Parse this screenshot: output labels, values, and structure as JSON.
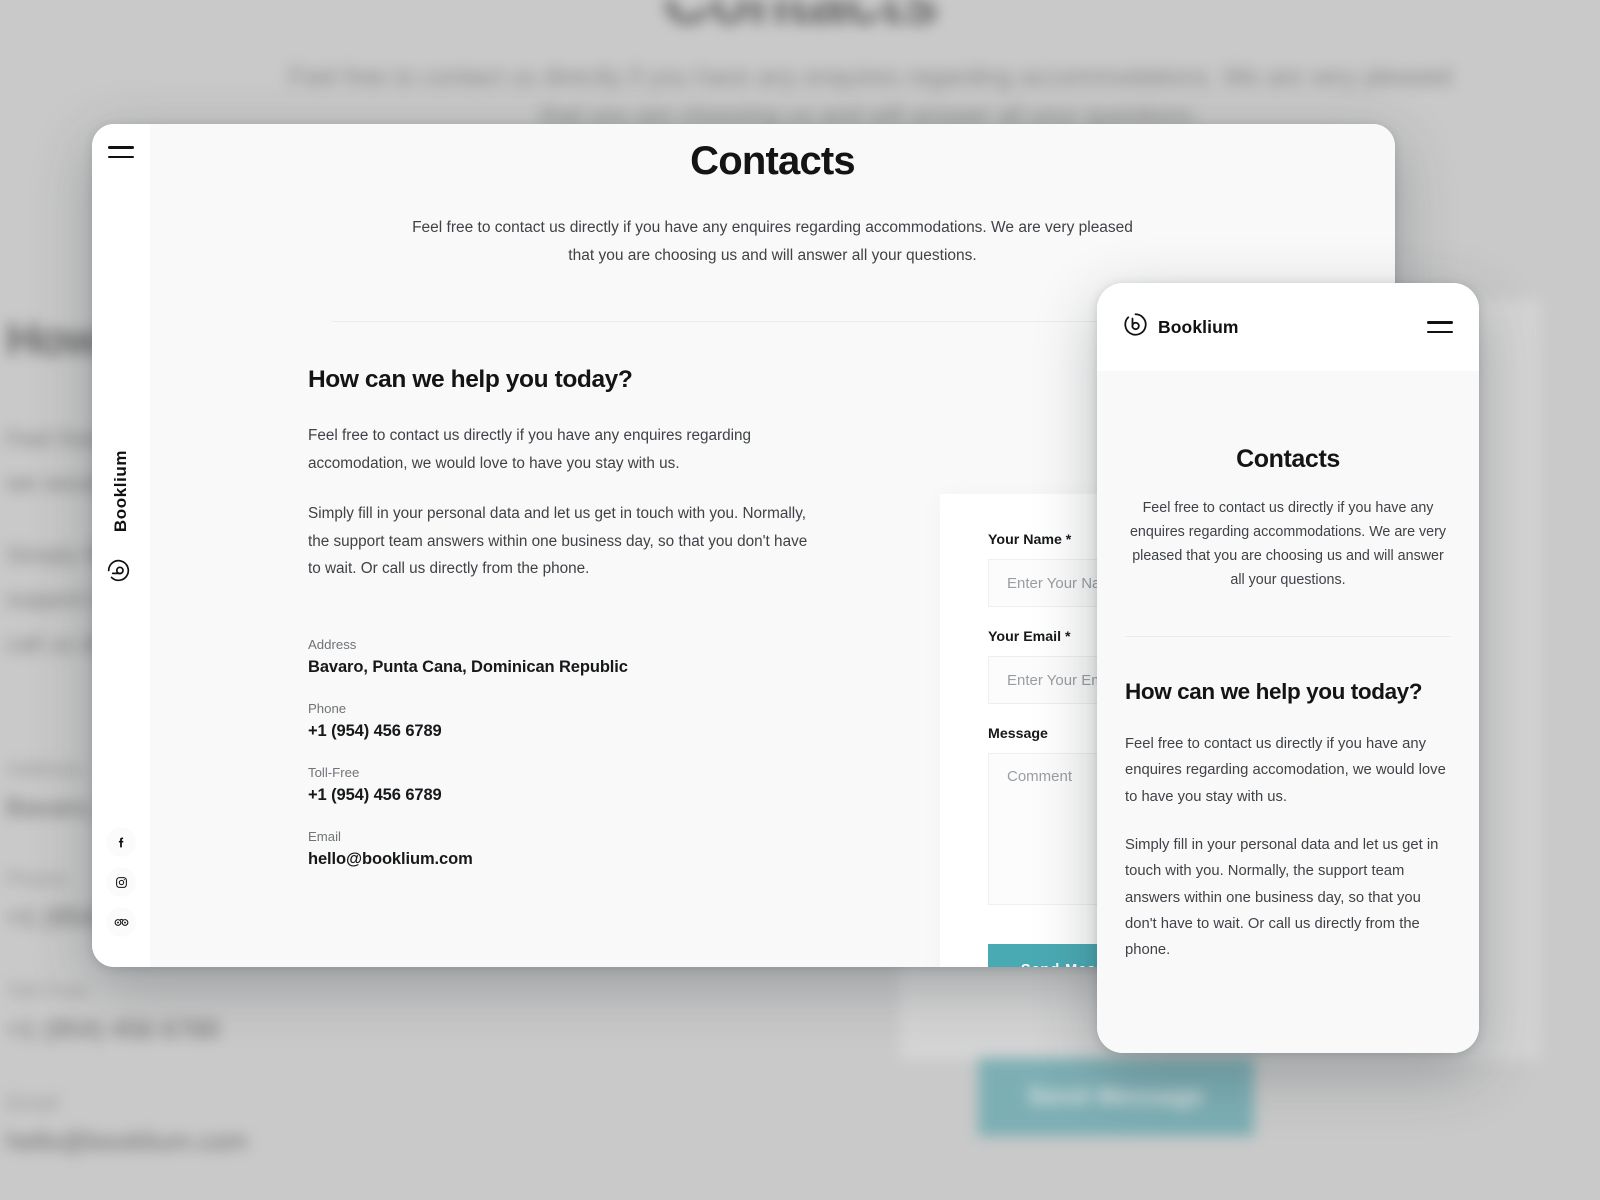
{
  "brand": {
    "name": "Booklium",
    "logo_icon": "booklium-b-circle-logo"
  },
  "page": {
    "title": "Contacts",
    "subtitle": "Feel free to contact us directly if you have any enquires regarding accommodations. We are very pleased that you are choosing us and will answer all your questions.",
    "heading": "How can we help you today?",
    "paragraph_1": "Feel free to contact us directly if you have any enquires regarding accomodation, we would love to have you stay with us.",
    "paragraph_2": "Simply fill in your personal data and let us get in touch with you. Normally, the support team answers within one business day, so that you don't have to wait. Or call us directly from the phone."
  },
  "details": [
    {
      "label": "Address",
      "value": "Bavaro, Punta Cana, Dominican Republic"
    },
    {
      "label": "Phone",
      "value": "+1 (954) 456 6789"
    },
    {
      "label": "Toll-Free",
      "value": "+1 (954) 456 6789"
    },
    {
      "label": "Email",
      "value": "hello@booklium.com"
    }
  ],
  "form": {
    "name_label": "Your Name *",
    "name_placeholder": "Enter Your Name",
    "name_value": "",
    "email_label": "Your Email *",
    "email_placeholder": "Enter Your Email",
    "email_value": "",
    "message_label": "Message",
    "message_placeholder": "Comment",
    "message_value": "",
    "submit_label": "Send Message"
  },
  "social": [
    {
      "name": "facebook-icon",
      "glyph": "f"
    },
    {
      "name": "instagram-icon",
      "glyph": "▣"
    },
    {
      "name": "tripadvisor-icon",
      "glyph": "◎"
    }
  ],
  "nav": {
    "menu_icon": "hamburger-menu-icon"
  },
  "colors": {
    "accent": "#4aaab4",
    "page_bg": "#f9f9f9",
    "card_bg": "#ffffff",
    "backdrop": "#c9c9c9",
    "text_primary": "#141414",
    "text_secondary": "#3f4246",
    "text_muted": "#6f7478"
  }
}
